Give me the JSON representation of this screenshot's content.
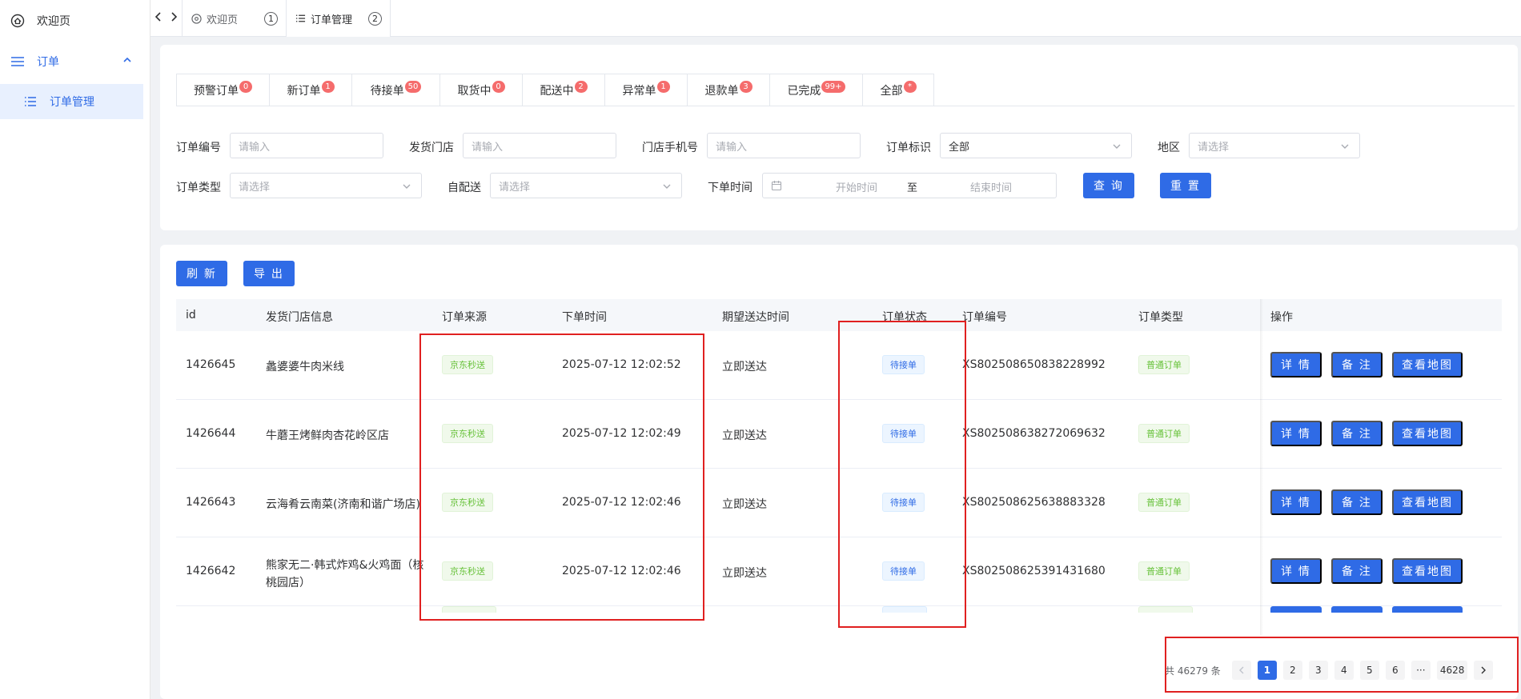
{
  "sidebar": {
    "items": [
      {
        "label": "欢迎页",
        "icon": "home-icon"
      },
      {
        "label": "订单",
        "icon": "menu-icon"
      },
      {
        "label": "订单管理",
        "icon": "list-icon"
      }
    ]
  },
  "tabs": [
    {
      "label": "欢迎页",
      "num": "1"
    },
    {
      "label": "订单管理",
      "num": "2"
    }
  ],
  "status_tabs": [
    {
      "label": "预警订单",
      "badge": "0"
    },
    {
      "label": "新订单",
      "badge": "1"
    },
    {
      "label": "待接单",
      "badge": "50"
    },
    {
      "label": "取货中",
      "badge": "0"
    },
    {
      "label": "配送中",
      "badge": "2"
    },
    {
      "label": "异常单",
      "badge": "1"
    },
    {
      "label": "退款单",
      "badge": "3"
    },
    {
      "label": "已完成",
      "badge": "99+"
    },
    {
      "label": "全部",
      "badge": "*"
    }
  ],
  "filters": {
    "order_no": {
      "label": "订单编号",
      "placeholder": "请输入"
    },
    "store": {
      "label": "发货门店",
      "placeholder": "请输入"
    },
    "phone": {
      "label": "门店手机号",
      "placeholder": "请输入"
    },
    "mark": {
      "label": "订单标识",
      "value": "全部"
    },
    "region": {
      "label": "地区",
      "placeholder": "请选择"
    },
    "type": {
      "label": "订单类型",
      "placeholder": "请选择"
    },
    "self_delivery": {
      "label": "自配送",
      "placeholder": "请选择"
    },
    "time": {
      "label": "下单时间",
      "start": "开始时间",
      "sep": "至",
      "end": "结束时间"
    },
    "query_label": "查 询",
    "reset_label": "重 置"
  },
  "toolbar": {
    "refresh_label": "刷 新",
    "export_label": "导 出"
  },
  "table": {
    "headers": {
      "id": "id",
      "store": "发货门店信息",
      "source": "订单来源",
      "order_time": "下单时间",
      "expect_time": "期望送达时间",
      "status": "订单状态",
      "order_no": "订单编号",
      "type": "订单类型",
      "ops": "操作"
    },
    "rows": [
      {
        "id": "1426645",
        "store": "蠡婆婆牛肉米线",
        "source": "京东秒送",
        "time": "2025-07-12 12:02:52",
        "expect": "立即送达",
        "status": "待接单",
        "order_no": "XS802508650838228992",
        "type": "普通订单"
      },
      {
        "id": "1426644",
        "store": "牛蘑王烤鲜肉杏花岭区店",
        "source": "京东秒送",
        "time": "2025-07-12 12:02:49",
        "expect": "立即送达",
        "status": "待接单",
        "order_no": "XS802508638272069632",
        "type": "普通订单"
      },
      {
        "id": "1426643",
        "store": "云海肴云南菜(济南和谐广场店)",
        "source": "京东秒送",
        "time": "2025-07-12 12:02:46",
        "expect": "立即送达",
        "status": "待接单",
        "order_no": "XS802508625638883328",
        "type": "普通订单"
      },
      {
        "id": "1426642",
        "store": "熊家无二·韩式炸鸡&火鸡面（核桃园店）",
        "store_line1": "熊家无二·韩式炸鸡&火鸡面（核",
        "store_line2": "桃园店）",
        "source": "京东秒送",
        "time": "2025-07-12 12:02:46",
        "expect": "立即送达",
        "status": "待接单",
        "order_no": "XS802508625391431680",
        "type": "普通订单"
      }
    ],
    "row_actions": {
      "detail": "详 情",
      "note": "备 注",
      "map": "查看地图"
    }
  },
  "pagination": {
    "total": "共 46279 条",
    "pages": [
      "1",
      "2",
      "3",
      "4",
      "5",
      "6"
    ],
    "ellipsis": "···",
    "last": "4628",
    "current": "1"
  },
  "colors": {
    "primary": "#2f6be6",
    "highlight": "#e02020",
    "badge": "#f56c6c"
  }
}
